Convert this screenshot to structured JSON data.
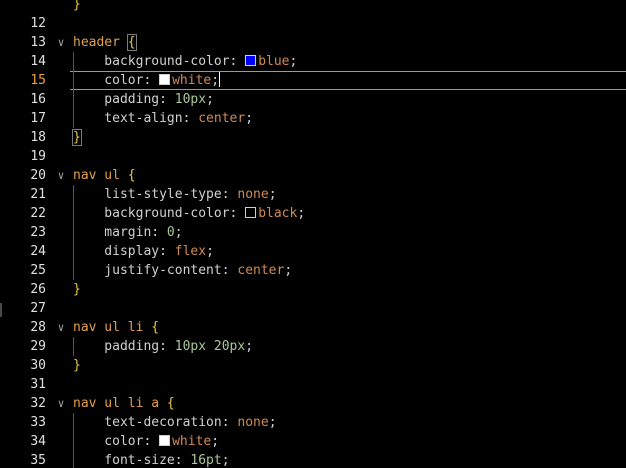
{
  "editor": {
    "lines": [
      {
        "n": "",
        "fold": "",
        "indent": false,
        "current": false,
        "tokens": [
          {
            "t": "brace",
            "v": "}"
          }
        ]
      },
      {
        "n": "12",
        "fold": "",
        "indent": false,
        "current": false,
        "tokens": []
      },
      {
        "n": "13",
        "fold": "v",
        "indent": false,
        "current": false,
        "tokens": [
          {
            "t": "sel",
            "v": "header "
          },
          {
            "t": "brace-box",
            "v": "{"
          }
        ]
      },
      {
        "n": "14",
        "fold": "",
        "indent": true,
        "current": false,
        "tokens": [
          {
            "t": "prop",
            "v": "    background-color: "
          },
          {
            "t": "swatch",
            "color": "#0000ff"
          },
          {
            "t": "kw",
            "v": "blue"
          },
          {
            "t": "punct",
            "v": ";"
          }
        ]
      },
      {
        "n": "15",
        "fold": "",
        "indent": true,
        "current": true,
        "tokens": [
          {
            "t": "prop",
            "v": "    color: "
          },
          {
            "t": "swatch",
            "color": "#ffffff"
          },
          {
            "t": "kw",
            "v": "white"
          },
          {
            "t": "punct",
            "v": ";"
          },
          {
            "t": "cursor"
          }
        ]
      },
      {
        "n": "16",
        "fold": "",
        "indent": true,
        "current": false,
        "tokens": [
          {
            "t": "prop",
            "v": "    padding: "
          },
          {
            "t": "num",
            "v": "10px"
          },
          {
            "t": "punct",
            "v": ";"
          }
        ]
      },
      {
        "n": "17",
        "fold": "",
        "indent": true,
        "current": false,
        "tokens": [
          {
            "t": "prop",
            "v": "    text-align: "
          },
          {
            "t": "kw",
            "v": "center"
          },
          {
            "t": "punct",
            "v": ";"
          }
        ]
      },
      {
        "n": "18",
        "fold": "",
        "indent": false,
        "current": false,
        "tokens": [
          {
            "t": "brace-box",
            "v": "}"
          }
        ]
      },
      {
        "n": "19",
        "fold": "",
        "indent": false,
        "current": false,
        "tokens": []
      },
      {
        "n": "20",
        "fold": "v",
        "indent": false,
        "current": false,
        "tokens": [
          {
            "t": "sel",
            "v": "nav ul "
          },
          {
            "t": "brace",
            "v": "{"
          }
        ]
      },
      {
        "n": "21",
        "fold": "",
        "indent": true,
        "current": false,
        "tokens": [
          {
            "t": "prop",
            "v": "    list-style-type: "
          },
          {
            "t": "kw",
            "v": "none"
          },
          {
            "t": "punct",
            "v": ";"
          }
        ]
      },
      {
        "n": "22",
        "fold": "",
        "indent": true,
        "current": false,
        "tokens": [
          {
            "t": "prop",
            "v": "    background-color: "
          },
          {
            "t": "swatch",
            "color": "#000000"
          },
          {
            "t": "kw",
            "v": "black"
          },
          {
            "t": "punct",
            "v": ";"
          }
        ]
      },
      {
        "n": "23",
        "fold": "",
        "indent": true,
        "current": false,
        "tokens": [
          {
            "t": "prop",
            "v": "    margin: "
          },
          {
            "t": "num",
            "v": "0"
          },
          {
            "t": "punct",
            "v": ";"
          }
        ]
      },
      {
        "n": "24",
        "fold": "",
        "indent": true,
        "current": false,
        "tokens": [
          {
            "t": "prop",
            "v": "    display: "
          },
          {
            "t": "kw",
            "v": "flex"
          },
          {
            "t": "punct",
            "v": ";"
          }
        ]
      },
      {
        "n": "25",
        "fold": "",
        "indent": true,
        "current": false,
        "tokens": [
          {
            "t": "prop",
            "v": "    justify-content: "
          },
          {
            "t": "kw",
            "v": "center"
          },
          {
            "t": "punct",
            "v": ";"
          }
        ]
      },
      {
        "n": "26",
        "fold": "",
        "indent": false,
        "current": false,
        "tokens": [
          {
            "t": "brace",
            "v": "}"
          }
        ]
      },
      {
        "n": "27",
        "fold": "",
        "indent": false,
        "current": false,
        "tokens": []
      },
      {
        "n": "28",
        "fold": "v",
        "indent": false,
        "current": false,
        "tokens": [
          {
            "t": "sel",
            "v": "nav ul li "
          },
          {
            "t": "brace",
            "v": "{"
          }
        ]
      },
      {
        "n": "29",
        "fold": "",
        "indent": true,
        "current": false,
        "tokens": [
          {
            "t": "prop",
            "v": "    padding: "
          },
          {
            "t": "num",
            "v": "10px 20px"
          },
          {
            "t": "punct",
            "v": ";"
          }
        ]
      },
      {
        "n": "30",
        "fold": "",
        "indent": false,
        "current": false,
        "tokens": [
          {
            "t": "brace",
            "v": "}"
          }
        ]
      },
      {
        "n": "31",
        "fold": "",
        "indent": false,
        "current": false,
        "tokens": []
      },
      {
        "n": "32",
        "fold": "v",
        "indent": false,
        "current": false,
        "tokens": [
          {
            "t": "sel",
            "v": "nav ul li a "
          },
          {
            "t": "brace",
            "v": "{"
          }
        ]
      },
      {
        "n": "33",
        "fold": "",
        "indent": true,
        "current": false,
        "tokens": [
          {
            "t": "prop",
            "v": "    text-decoration: "
          },
          {
            "t": "kw",
            "v": "none"
          },
          {
            "t": "punct",
            "v": ";"
          }
        ]
      },
      {
        "n": "34",
        "fold": "",
        "indent": true,
        "current": false,
        "tokens": [
          {
            "t": "prop",
            "v": "    color: "
          },
          {
            "t": "swatch",
            "color": "#ffffff"
          },
          {
            "t": "kw",
            "v": "white"
          },
          {
            "t": "punct",
            "v": ";"
          }
        ]
      },
      {
        "n": "35",
        "fold": "",
        "indent": true,
        "current": false,
        "tokens": [
          {
            "t": "prop",
            "v": "    font-size: "
          },
          {
            "t": "num",
            "v": "16pt"
          },
          {
            "t": "punct",
            "v": ";"
          }
        ]
      },
      {
        "n": "",
        "fold": "",
        "indent": false,
        "current": false,
        "tokens": [
          {
            "t": "brace",
            "v": "}"
          }
        ]
      }
    ],
    "colors": {
      "background": "#000000",
      "selector": "#e3a04a",
      "brace": "#e8c84a",
      "keyword_value": "#d08a52",
      "number_value": "#a9c79a",
      "current_line_border": "#e28a2c"
    }
  }
}
